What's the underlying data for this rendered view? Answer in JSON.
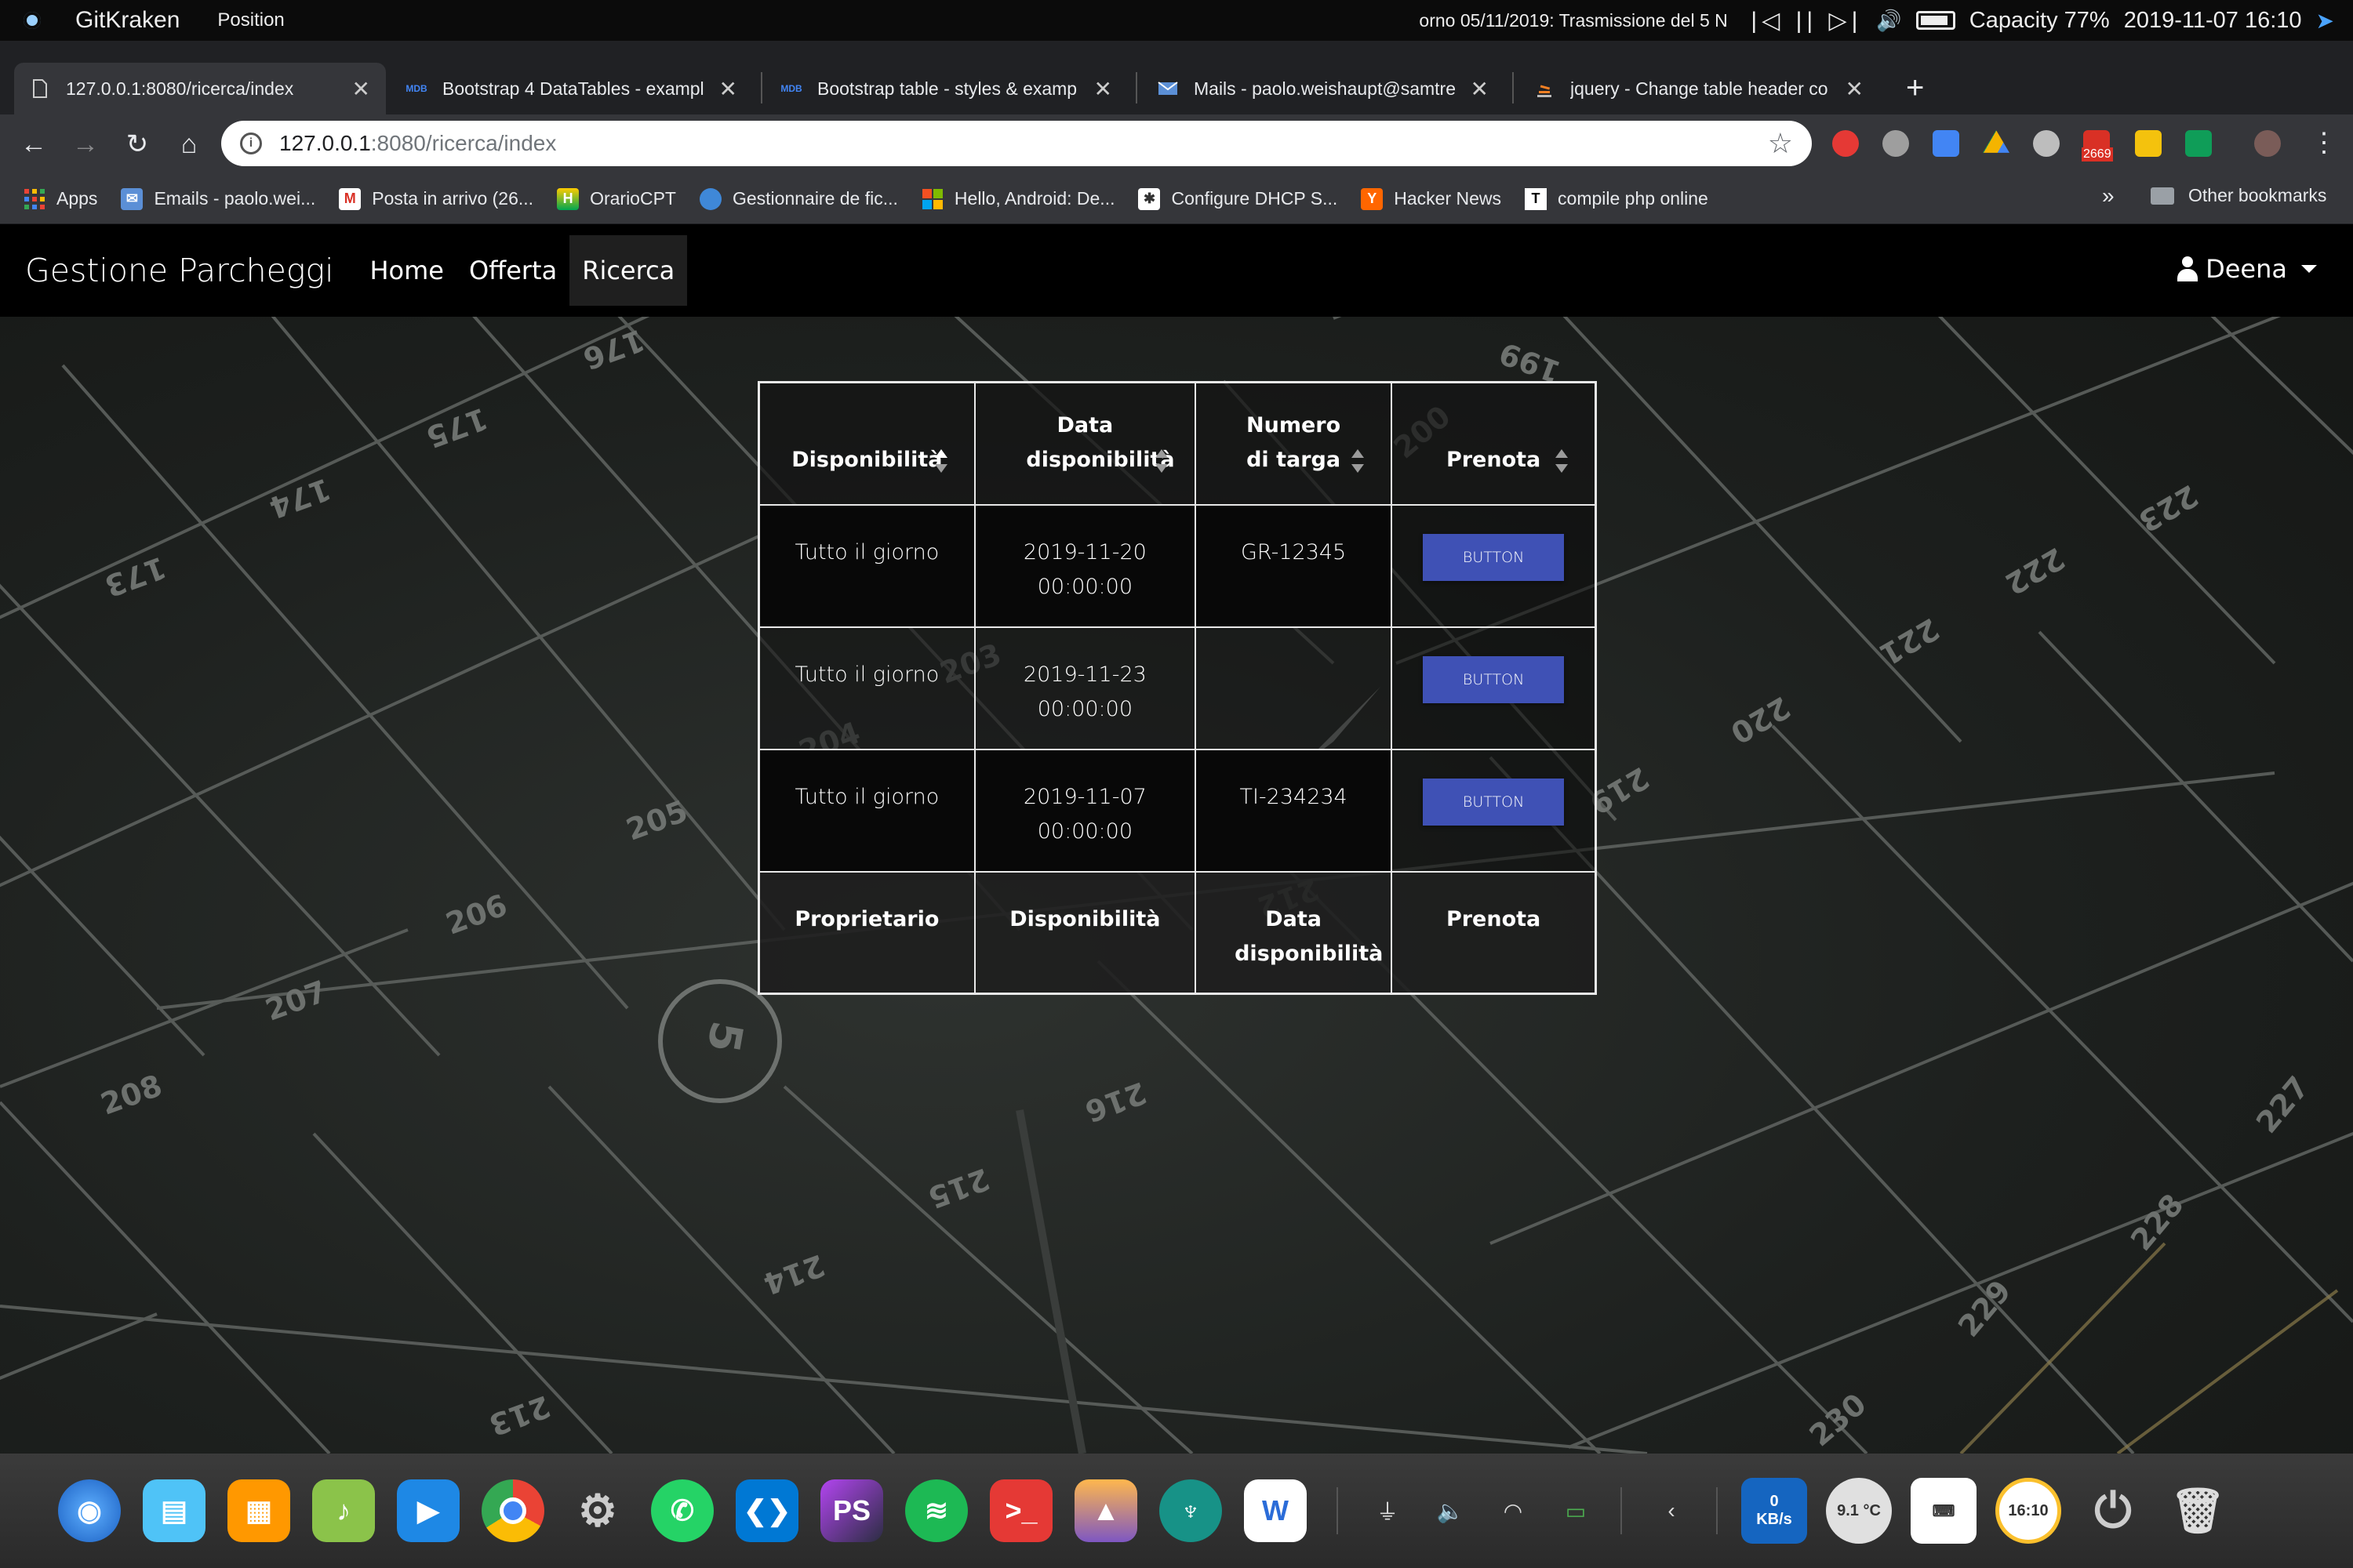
{
  "system_bar": {
    "app_name": "GitKraken",
    "menu_item": "Position",
    "ticker": "orno 05/11/2019: Trasmissione del 5 N",
    "media_controls": "|◁ || ▷|",
    "capacity": "Capacity 77%",
    "clock": "2019-11-07 16:10"
  },
  "tabs": [
    {
      "title": "127.0.0.1:8080/ricerca/index",
      "favicon": "page-icon",
      "active": true
    },
    {
      "title": "Bootstrap 4 DataTables - exampl",
      "favicon": "mdb-icon",
      "favicon_text": "MDB"
    },
    {
      "title": "Bootstrap table - styles & examp",
      "favicon": "mdb-icon",
      "favicon_text": "MDB"
    },
    {
      "title": "Mails - paolo.weishaupt@samtre",
      "favicon": "mail-icon"
    },
    {
      "title": "jquery - Change table header co",
      "favicon": "stackoverflow-icon"
    }
  ],
  "address_bar": {
    "url_host": "127.0.0.1",
    "url_path": ":8080/ricerca/index"
  },
  "extensions": {
    "gmail_badge": "2669"
  },
  "bookmarks": [
    {
      "label": "Apps",
      "icon": "apps-grid-icon"
    },
    {
      "label": "Emails - paolo.wei...",
      "icon": "mail-icon"
    },
    {
      "label": "Posta in arrivo (26...",
      "icon": "gmail-icon"
    },
    {
      "label": "OrarioCPT",
      "icon": "h-icon"
    },
    {
      "label": "Gestionnaire de fic...",
      "icon": "globe-icon"
    },
    {
      "label": "Hello, Android: De...",
      "icon": "windows-icon"
    },
    {
      "label": "Configure DHCP S...",
      "icon": "config-icon"
    },
    {
      "label": "Hacker News",
      "icon": "y-icon"
    },
    {
      "label": "compile php online",
      "icon": "t-icon"
    }
  ],
  "bookmarks_more": "»",
  "other_bookmarks": "Other bookmarks",
  "site": {
    "brand": "Gestione Parcheggi",
    "nav": [
      "Home",
      "Offerta",
      "Ricerca"
    ],
    "active_nav": "Ricerca",
    "user": "Deena"
  },
  "table": {
    "headers": [
      "Disponibilità",
      "Data disponibilità",
      "Numero di targa",
      "Prenota"
    ],
    "rows": [
      {
        "disponibilita": "Tutto il giorno",
        "data": "2019-11-20 00:00:00",
        "targa": "GR-12345",
        "button": "BUTTON"
      },
      {
        "disponibilita": "Tutto il giorno",
        "data": "2019-11-23 00:00:00",
        "targa": "",
        "button": "BUTTON"
      },
      {
        "disponibilita": "Tutto il giorno",
        "data": "2019-11-07 00:00:00",
        "targa": "TI-234234",
        "button": "BUTTON"
      }
    ],
    "footers": [
      "Proprietario",
      "Disponibilità",
      "Data disponibilità",
      "Prenota"
    ]
  },
  "parking_numbers": [
    "176",
    "175",
    "174",
    "173",
    "199",
    "223",
    "222",
    "221",
    "220",
    "219",
    "203",
    "204",
    "205",
    "206",
    "207",
    "208",
    "216",
    "215",
    "214",
    "213",
    "227",
    "228",
    "229",
    "230",
    "212",
    "200",
    "5"
  ],
  "dock": {
    "network_speed_value": "0",
    "network_speed_unit": "KB/s",
    "weather": "9.1 °C",
    "clock_widget": "16:10"
  },
  "colors": {
    "primary_button": "#3f51b5",
    "navbar": "#000000",
    "tab_bar": "#202124",
    "toolbar": "#35363a"
  }
}
